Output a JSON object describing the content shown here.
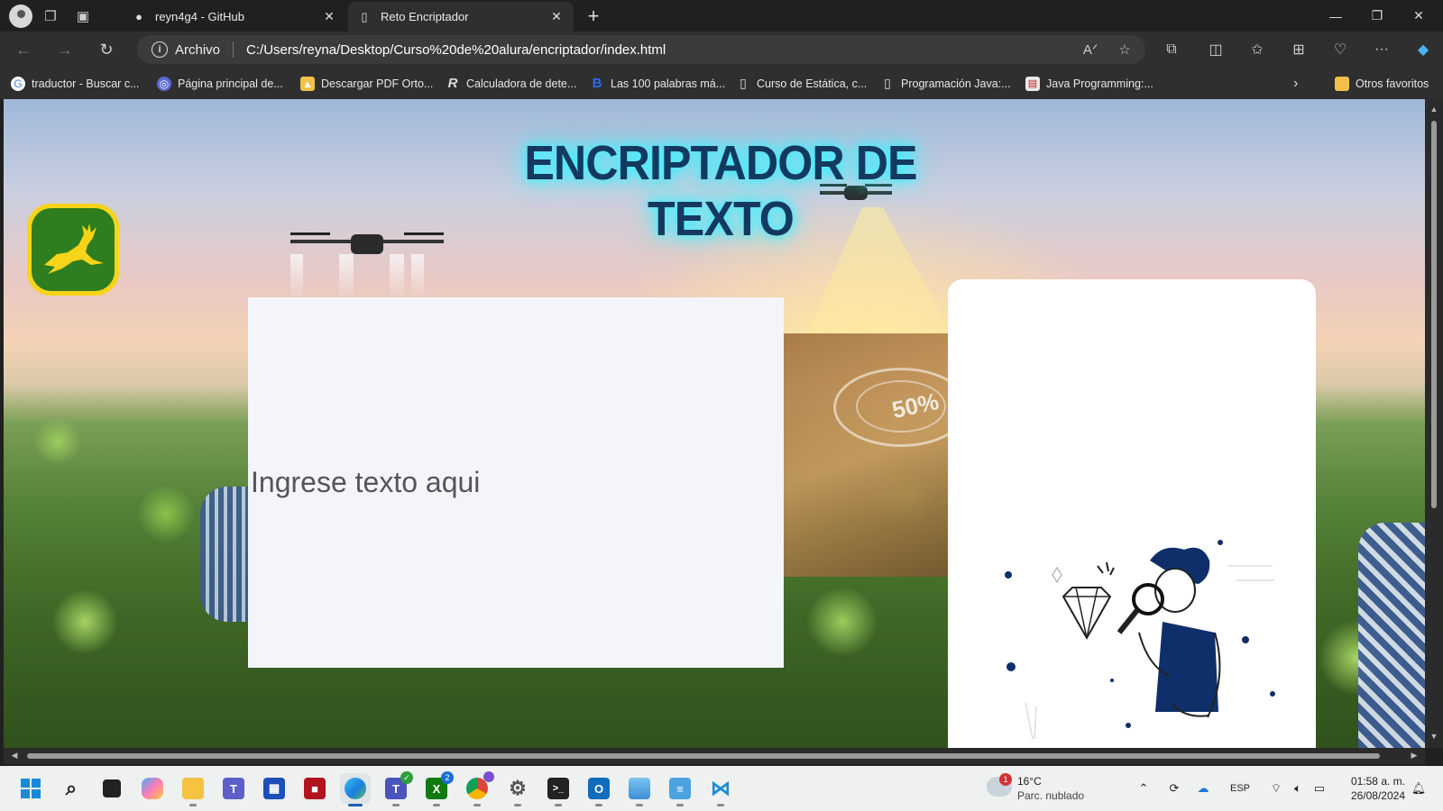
{
  "browser": {
    "tabs": [
      {
        "label": "reyn4g4 - GitHub",
        "icon": "github-icon",
        "active": false
      },
      {
        "label": "Reto Encriptador",
        "icon": "page-icon",
        "active": true
      }
    ],
    "address": {
      "scheme_label": "Archivo",
      "url": "C:/Users/reyna/Desktop/Curso%20de%20alura/encriptador/index.html"
    },
    "bookmarks": [
      {
        "label": "traductor - Buscar c...",
        "icon": "google-icon"
      },
      {
        "label": "Página principal de...",
        "icon": "globe-icon"
      },
      {
        "label": "Descargar PDF Orto...",
        "icon": "image-icon"
      },
      {
        "label": "Calculadora de dete...",
        "icon": "r-icon"
      },
      {
        "label": "Las 100 palabras má...",
        "icon": "b-icon"
      },
      {
        "label": "Curso de Estática, c...",
        "icon": "page-icon"
      },
      {
        "label": "Programación Java:...",
        "icon": "page-icon"
      },
      {
        "label": "Java Programming:...",
        "icon": "book-icon"
      }
    ],
    "other_favorites_label": "Otros favoritos"
  },
  "page": {
    "title": "ENCRIPTADOR DE TEXTO",
    "input_placeholder": "Ingrese texto aqui",
    "accent_glow": "#3ff0ff",
    "title_color": "#14395f",
    "logo_colors": {
      "yellow": "#f6d41a",
      "green": "#2e7d1e"
    }
  },
  "taskbar": {
    "apps": [
      {
        "name": "start-button"
      },
      {
        "name": "search-button"
      },
      {
        "name": "task-view-button"
      },
      {
        "name": "copilot-app"
      },
      {
        "name": "file-explorer-app"
      },
      {
        "name": "teams-app"
      },
      {
        "name": "store-app"
      },
      {
        "name": "red-app"
      },
      {
        "name": "edge-app",
        "active": true
      },
      {
        "name": "teams-work-app"
      },
      {
        "name": "xbox-app",
        "badge": "2"
      },
      {
        "name": "chrome-app"
      },
      {
        "name": "settings-app"
      },
      {
        "name": "terminal-app"
      },
      {
        "name": "outlook-app"
      },
      {
        "name": "photos-app"
      },
      {
        "name": "notepad-app"
      },
      {
        "name": "vscode-app"
      }
    ],
    "weather": {
      "temp": "16°C",
      "desc": "Parc. nublado",
      "badge": "1"
    },
    "language": "ESP",
    "time": "01:58 a. m.",
    "date": "26/08/2024"
  }
}
